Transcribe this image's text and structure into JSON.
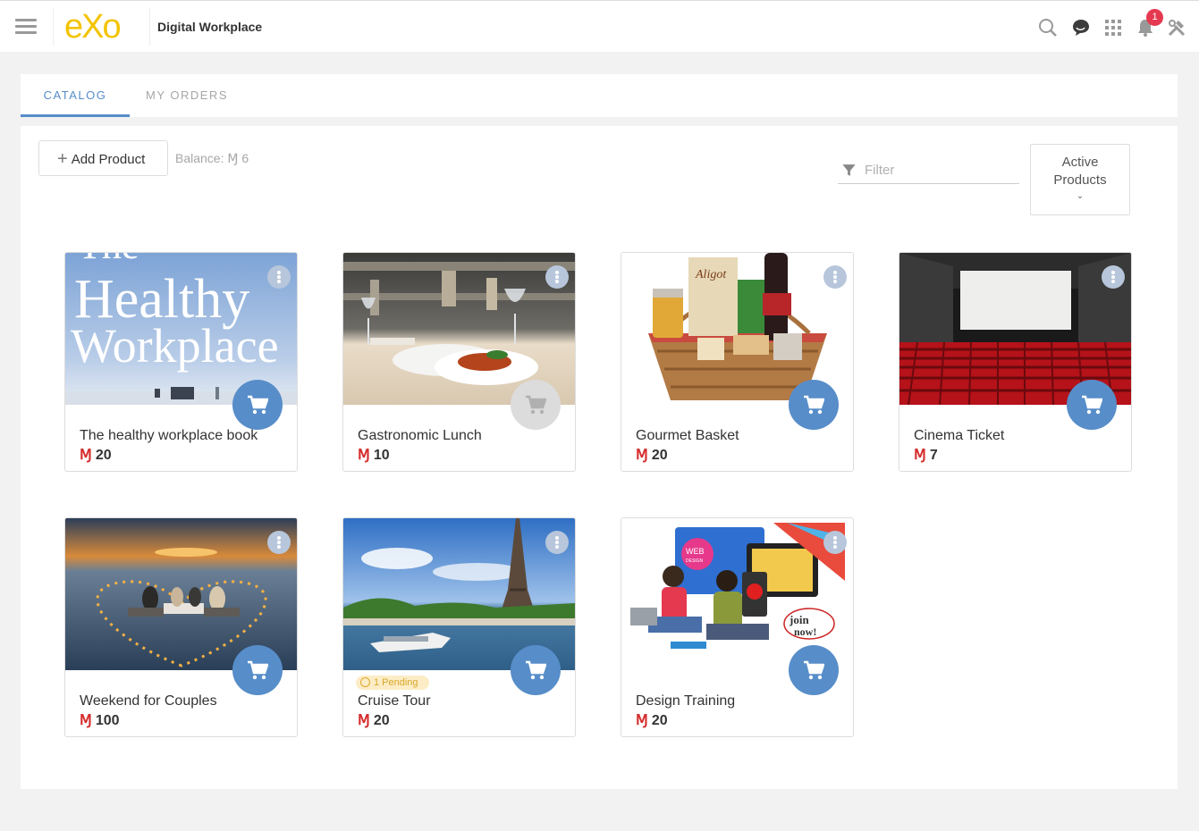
{
  "header": {
    "logo_text": "eXo",
    "site_title": "Digital Workplace",
    "notification_count": "1",
    "icons": [
      "menu-icon",
      "search-icon",
      "chat-icon",
      "apps-icon",
      "bell-icon",
      "tools-icon"
    ],
    "brand_color": "#f3c400",
    "badge_color": "#e53950"
  },
  "tabs": [
    {
      "label": "CATALOG",
      "active": true
    },
    {
      "label": "MY ORDERS",
      "active": false
    }
  ],
  "toolbar": {
    "add_label": "Add Product",
    "balance_label": "Balance: Ɱ 6",
    "filter_placeholder": "Filter",
    "status_line1": "Active",
    "status_line2": "Products"
  },
  "accent_color": "#578dc9",
  "currency_symbol": "Ɱ",
  "products": [
    {
      "title": "The healthy workplace book",
      "price": "20",
      "can_buy": true
    },
    {
      "title": "Gastronomic Lunch",
      "price": "10",
      "can_buy": false
    },
    {
      "title": "Gourmet Basket",
      "price": "20",
      "can_buy": true
    },
    {
      "title": "Cinema Ticket",
      "price": "7",
      "can_buy": true
    },
    {
      "title": "Weekend for Couples",
      "price": "100",
      "can_buy": true
    },
    {
      "title": "Cruise Tour",
      "price": "20",
      "can_buy": true,
      "pending": "1 Pending"
    },
    {
      "title": "Design Training",
      "price": "20",
      "can_buy": true
    }
  ],
  "images": {
    "book_line1": "Healthy",
    "book_line2": "Workplace",
    "book_line0": "The",
    "basket_label": "Aligot",
    "design_web": "WEB",
    "design_web2": "DESIGN",
    "design_join": "join",
    "design_now": "now!"
  }
}
